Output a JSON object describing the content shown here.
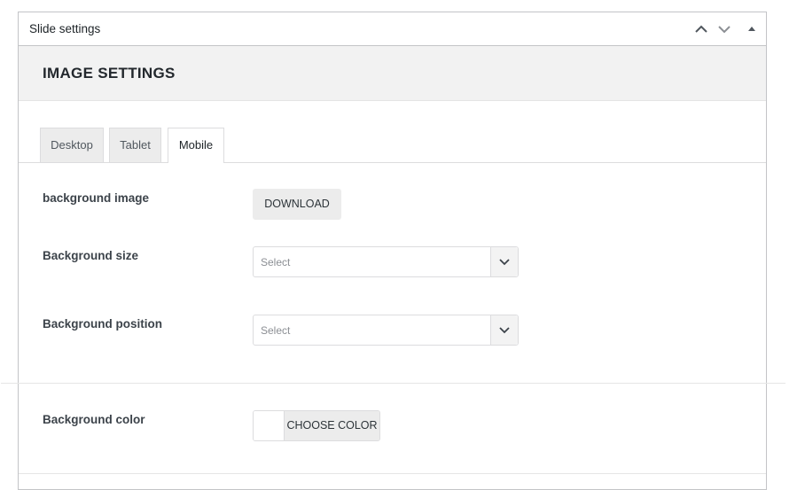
{
  "metabox": {
    "title": "Slide settings",
    "controls": [
      "chevron-up-icon",
      "chevron-down-icon",
      "triangle-up-icon"
    ]
  },
  "section": {
    "title": "IMAGE SETTINGS"
  },
  "tabs": [
    {
      "label": "Desktop",
      "active": false
    },
    {
      "label": "Tablet",
      "active": false
    },
    {
      "label": "Mobile",
      "active": true
    }
  ],
  "fields": {
    "background_image": {
      "label": "background image",
      "button": "DOWNLOAD"
    },
    "background_size": {
      "label": "Background size",
      "placeholder": "Select"
    },
    "background_position": {
      "label": "Background position",
      "placeholder": "Select"
    },
    "background_color": {
      "label": "Background color",
      "button": "CHOOSE COLOR",
      "value": "#ffffff"
    }
  }
}
